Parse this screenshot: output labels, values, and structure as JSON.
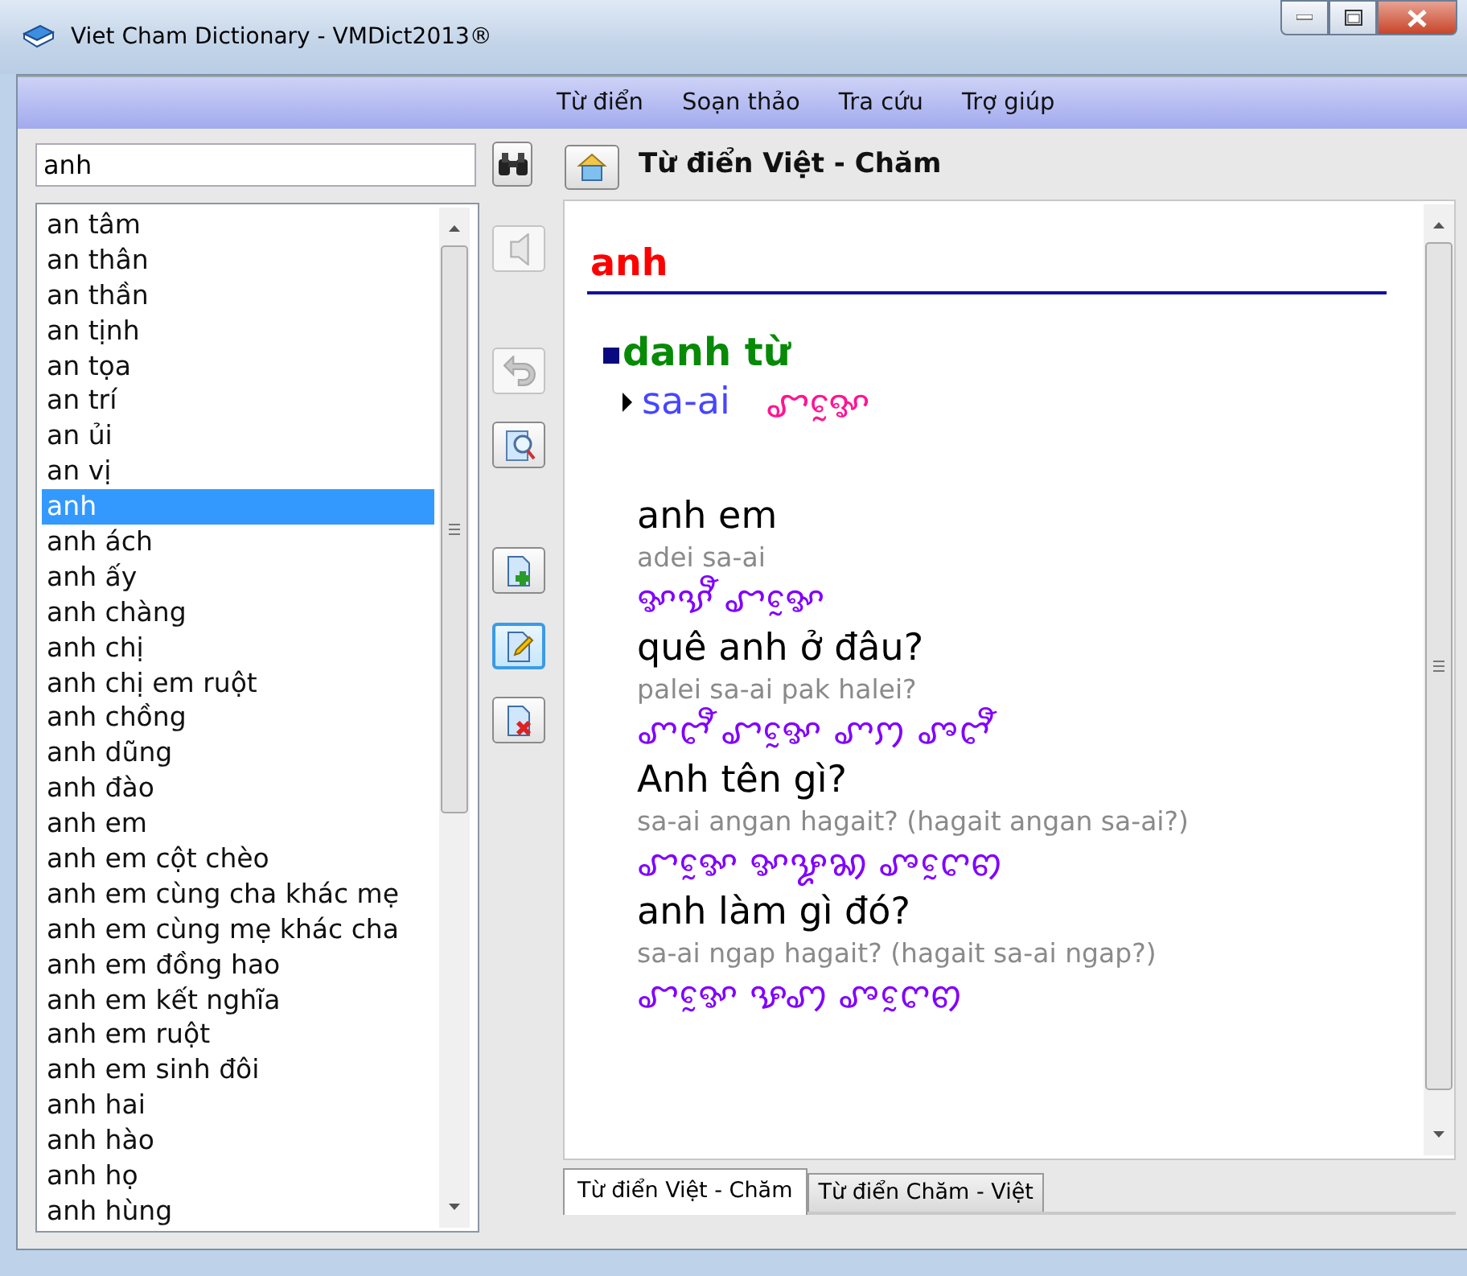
{
  "window": {
    "title": "Viet Cham Dictionary - VMDict2013®"
  },
  "menu": [
    "Từ điển",
    "Soạn thảo",
    "Tra cứu",
    "Trợ giúp"
  ],
  "search": {
    "value": "anh"
  },
  "word_list": [
    {
      "text": "an tâm",
      "selected": false
    },
    {
      "text": "an thân",
      "selected": false
    },
    {
      "text": "an thần",
      "selected": false
    },
    {
      "text": "an tịnh",
      "selected": false
    },
    {
      "text": "an tọa",
      "selected": false
    },
    {
      "text": "an trí",
      "selected": false
    },
    {
      "text": "an ủi",
      "selected": false
    },
    {
      "text": "an vị",
      "selected": false
    },
    {
      "text": "anh",
      "selected": true
    },
    {
      "text": "anh ách",
      "selected": false
    },
    {
      "text": "anh ấy",
      "selected": false
    },
    {
      "text": "anh chàng",
      "selected": false
    },
    {
      "text": "anh chị",
      "selected": false
    },
    {
      "text": "anh chị em ruột",
      "selected": false
    },
    {
      "text": "anh chồng",
      "selected": false
    },
    {
      "text": "anh dũng",
      "selected": false
    },
    {
      "text": "anh đào",
      "selected": false
    },
    {
      "text": "anh em",
      "selected": false
    },
    {
      "text": "anh em cột chèo",
      "selected": false
    },
    {
      "text": "anh em cùng cha khác mẹ",
      "selected": false
    },
    {
      "text": "anh em cùng mẹ khác cha",
      "selected": false
    },
    {
      "text": "anh em đồng hao",
      "selected": false
    },
    {
      "text": "anh em kết nghĩa",
      "selected": false
    },
    {
      "text": "anh em ruột",
      "selected": false
    },
    {
      "text": "anh em sinh đôi",
      "selected": false
    },
    {
      "text": "anh hai",
      "selected": false
    },
    {
      "text": "anh hào",
      "selected": false
    },
    {
      "text": "anh họ",
      "selected": false
    },
    {
      "text": "anh hùng",
      "selected": false
    }
  ],
  "tool_buttons": [
    {
      "kind": "speaker",
      "disabled": true,
      "highlighted": false
    },
    {
      "kind": "undo",
      "disabled": true,
      "highlighted": false
    },
    {
      "kind": "lookup",
      "disabled": false,
      "highlighted": false
    },
    {
      "kind": "add",
      "disabled": false,
      "highlighted": false
    },
    {
      "kind": "edit",
      "disabled": false,
      "highlighted": true
    },
    {
      "kind": "delete",
      "disabled": false,
      "highlighted": false
    }
  ],
  "dictionary_title": "Từ điển Việt - Chăm",
  "entry": {
    "headword": "anh",
    "part_of_speech": "danh từ",
    "meaning": "sa-ai",
    "meaning_cham": "ꨧꨀꨰ",
    "examples": [
      {
        "vietnamese": "anh em",
        "cham_latin": "adei sa-ai",
        "cham_script": "ꨀꨕꨬ ꨧꨀꨰ"
      },
      {
        "vietnamese": "quê anh ở đâu?",
        "cham_latin": "palei sa-ai pak halei?",
        "cham_script": "ꨚꨤꨬ ꨧꨀꨰ ꨚꩀ ꨨꨤꨬ"
      },
      {
        "vietnamese": "Anh tên gì?",
        "cham_latin": "sa-ai angan hagait? (hagait angan sa-ai?)",
        "cham_script": "ꨧꨀꨰ ꨀꨋꩆ ꨨꨈꨰꩅ"
      },
      {
        "vietnamese": "anh làm gì đó?",
        "cham_latin": "sa-ai ngap hagait? (hagait sa-ai ngap?)",
        "cham_script": "ꨧꨀꨰ ꨊꩇ ꨨꨈꨰꩅ"
      }
    ]
  },
  "tabs": [
    {
      "label": "Từ điển Việt - Chăm",
      "selected": true
    },
    {
      "label": "Từ điển Chăm - Việt",
      "selected": false
    }
  ]
}
